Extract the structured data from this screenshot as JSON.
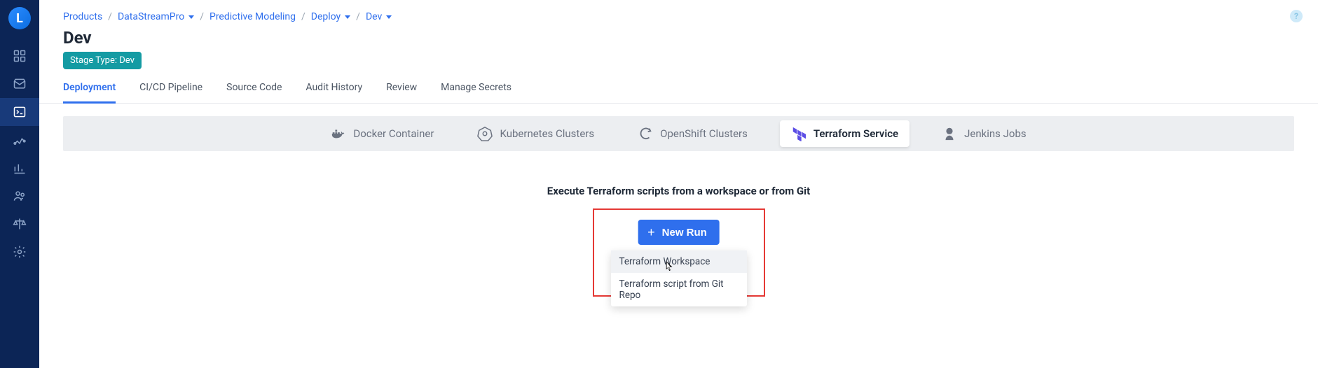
{
  "logo_letter": "L",
  "breadcrumb": {
    "items": [
      {
        "label": "Products",
        "dropdown": false
      },
      {
        "label": "DataStreamPro",
        "dropdown": true
      },
      {
        "label": "Predictive Modeling",
        "dropdown": false
      },
      {
        "label": "Deploy",
        "dropdown": true
      },
      {
        "label": "Dev",
        "dropdown": true
      }
    ]
  },
  "page": {
    "title": "Dev",
    "badge": "Stage Type: Dev"
  },
  "tabs": [
    "Deployment",
    "CI/CD Pipeline",
    "Source Code",
    "Audit History",
    "Review",
    "Manage Secrets"
  ],
  "deployment_types": [
    "Docker Container",
    "Kubernetes Clusters",
    "OpenShift Clusters",
    "Terraform Service",
    "Jenkins Jobs"
  ],
  "content": {
    "heading": "Execute Terraform scripts from a workspace or from Git",
    "new_run_label": "New Run",
    "dropdown": {
      "option1": "Terraform Workspace",
      "option2": "Terraform script from Git Repo"
    }
  },
  "help_symbol": "?"
}
